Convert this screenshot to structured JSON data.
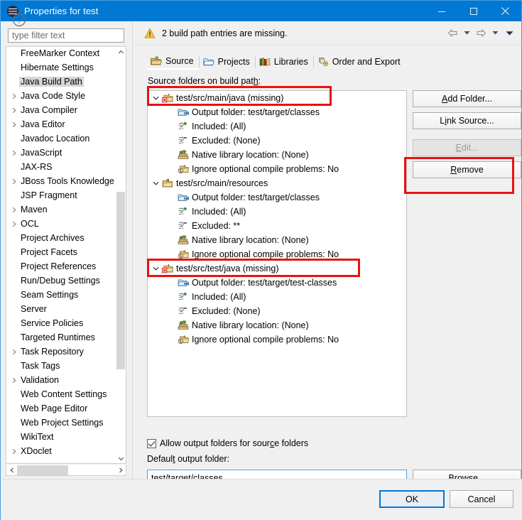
{
  "window": {
    "title": "Properties for test",
    "app_icon": "eclipse-icon",
    "minimize_label": "Minimize",
    "maximize_label": "Maximize",
    "close_label": "Close"
  },
  "sidebar": {
    "filter_placeholder": "type filter text",
    "items": [
      {
        "label": "FreeMarker Context",
        "expandable": false,
        "selected": false
      },
      {
        "label": "Hibernate Settings",
        "expandable": false,
        "selected": false
      },
      {
        "label": "Java Build Path",
        "expandable": false,
        "selected": true
      },
      {
        "label": "Java Code Style",
        "expandable": true,
        "selected": false
      },
      {
        "label": "Java Compiler",
        "expandable": true,
        "selected": false
      },
      {
        "label": "Java Editor",
        "expandable": true,
        "selected": false
      },
      {
        "label": "Javadoc Location",
        "expandable": false,
        "selected": false
      },
      {
        "label": "JavaScript",
        "expandable": true,
        "selected": false
      },
      {
        "label": "JAX-RS",
        "expandable": false,
        "selected": false
      },
      {
        "label": "JBoss Tools Knowledge",
        "expandable": true,
        "selected": false
      },
      {
        "label": "JSP Fragment",
        "expandable": false,
        "selected": false
      },
      {
        "label": "Maven",
        "expandable": true,
        "selected": false
      },
      {
        "label": "OCL",
        "expandable": true,
        "selected": false
      },
      {
        "label": "Project Archives",
        "expandable": false,
        "selected": false
      },
      {
        "label": "Project Facets",
        "expandable": false,
        "selected": false
      },
      {
        "label": "Project References",
        "expandable": false,
        "selected": false
      },
      {
        "label": "Run/Debug Settings",
        "expandable": false,
        "selected": false
      },
      {
        "label": "Seam Settings",
        "expandable": false,
        "selected": false
      },
      {
        "label": "Server",
        "expandable": false,
        "selected": false
      },
      {
        "label": "Service Policies",
        "expandable": false,
        "selected": false
      },
      {
        "label": "Targeted Runtimes",
        "expandable": false,
        "selected": false
      },
      {
        "label": "Task Repository",
        "expandable": true,
        "selected": false
      },
      {
        "label": "Task Tags",
        "expandable": false,
        "selected": false
      },
      {
        "label": "Validation",
        "expandable": true,
        "selected": false
      },
      {
        "label": "Web Content Settings",
        "expandable": false,
        "selected": false
      },
      {
        "label": "Web Page Editor",
        "expandable": false,
        "selected": false
      },
      {
        "label": "Web Project Settings",
        "expandable": false,
        "selected": false
      },
      {
        "label": "WikiText",
        "expandable": false,
        "selected": false
      },
      {
        "label": "XDoclet",
        "expandable": true,
        "selected": false
      }
    ]
  },
  "banner": {
    "warning_text": "2 build path entries are missing.",
    "warning_icon": "warning-triangle-icon",
    "nav": [
      {
        "icon": "back-arrow-icon"
      },
      {
        "icon": "chevron-down-icon"
      },
      {
        "icon": "forward-arrow-icon"
      },
      {
        "icon": "chevron-down-icon"
      },
      {
        "icon": "chevron-down-icon"
      }
    ]
  },
  "tabs": [
    {
      "label": "Source",
      "icon": "source-folder-icon",
      "active": true
    },
    {
      "label": "Projects",
      "icon": "projects-folder-icon",
      "active": false
    },
    {
      "label": "Libraries",
      "icon": "libraries-books-icon",
      "active": false
    },
    {
      "label": "Order and Export",
      "icon": "order-export-icon",
      "active": false
    }
  ],
  "main": {
    "source_label": "Source folders on build path:",
    "source_label_accel": "h",
    "tree": [
      {
        "depth": 0,
        "label": "test/src/main/java (missing)",
        "icon": "source-folder-missing-icon",
        "expanded": true,
        "highlighted": true
      },
      {
        "depth": 1,
        "label": "Output folder: test/target/classes",
        "icon": "output-folder-icon"
      },
      {
        "depth": 1,
        "label": "Included: (All)",
        "icon": "included-filter-icon"
      },
      {
        "depth": 1,
        "label": "Excluded: (None)",
        "icon": "excluded-filter-icon"
      },
      {
        "depth": 1,
        "label": "Native library location: (None)",
        "icon": "native-library-icon"
      },
      {
        "depth": 1,
        "label": "Ignore optional compile problems: No",
        "icon": "ignore-problems-icon"
      },
      {
        "depth": 0,
        "label": "test/src/main/resources",
        "icon": "source-folder-icon",
        "expanded": true,
        "highlighted": false
      },
      {
        "depth": 1,
        "label": "Output folder: test/target/classes",
        "icon": "output-folder-icon"
      },
      {
        "depth": 1,
        "label": "Included: (All)",
        "icon": "included-filter-icon"
      },
      {
        "depth": 1,
        "label": "Excluded: **",
        "icon": "excluded-filter-icon"
      },
      {
        "depth": 1,
        "label": "Native library location: (None)",
        "icon": "native-library-icon"
      },
      {
        "depth": 1,
        "label": "Ignore optional compile problems: No",
        "icon": "ignore-problems-icon"
      },
      {
        "depth": 0,
        "label": "test/src/test/java (missing)",
        "icon": "source-folder-missing-icon",
        "expanded": true,
        "highlighted": true
      },
      {
        "depth": 1,
        "label": "Output folder: test/target/test-classes",
        "icon": "output-folder-icon"
      },
      {
        "depth": 1,
        "label": "Included: (All)",
        "icon": "included-filter-icon"
      },
      {
        "depth": 1,
        "label": "Excluded: (None)",
        "icon": "excluded-filter-icon"
      },
      {
        "depth": 1,
        "label": "Native library location: (None)",
        "icon": "native-library-icon"
      },
      {
        "depth": 1,
        "label": "Ignore optional compile problems: No",
        "icon": "ignore-problems-icon"
      }
    ],
    "buttons": {
      "add_folder": "Add Folder...",
      "link_source": "Link Source...",
      "edit": "Edit...",
      "remove": "Remove",
      "browse": "Browse..."
    },
    "allow_output_folders_label": "Allow output folders for source folders",
    "allow_output_folders_checked": true,
    "default_output_label": "Default output folder:",
    "default_output_value": "test/target/classes"
  },
  "footer": {
    "help_icon": "help-question-icon",
    "ok_label": "OK",
    "cancel_label": "Cancel"
  },
  "annotations": {
    "highlight_color": "#e8120f",
    "boxes": [
      {
        "target": "test/src/main/java (missing)"
      },
      {
        "target": "test/src/test/java (missing)"
      },
      {
        "target": "Remove"
      }
    ]
  },
  "colors": {
    "titlebar": "#0078d4",
    "accent": "#0078d4",
    "dialog_bg": "#f0f0f0",
    "annotation_red": "#e8120f"
  }
}
